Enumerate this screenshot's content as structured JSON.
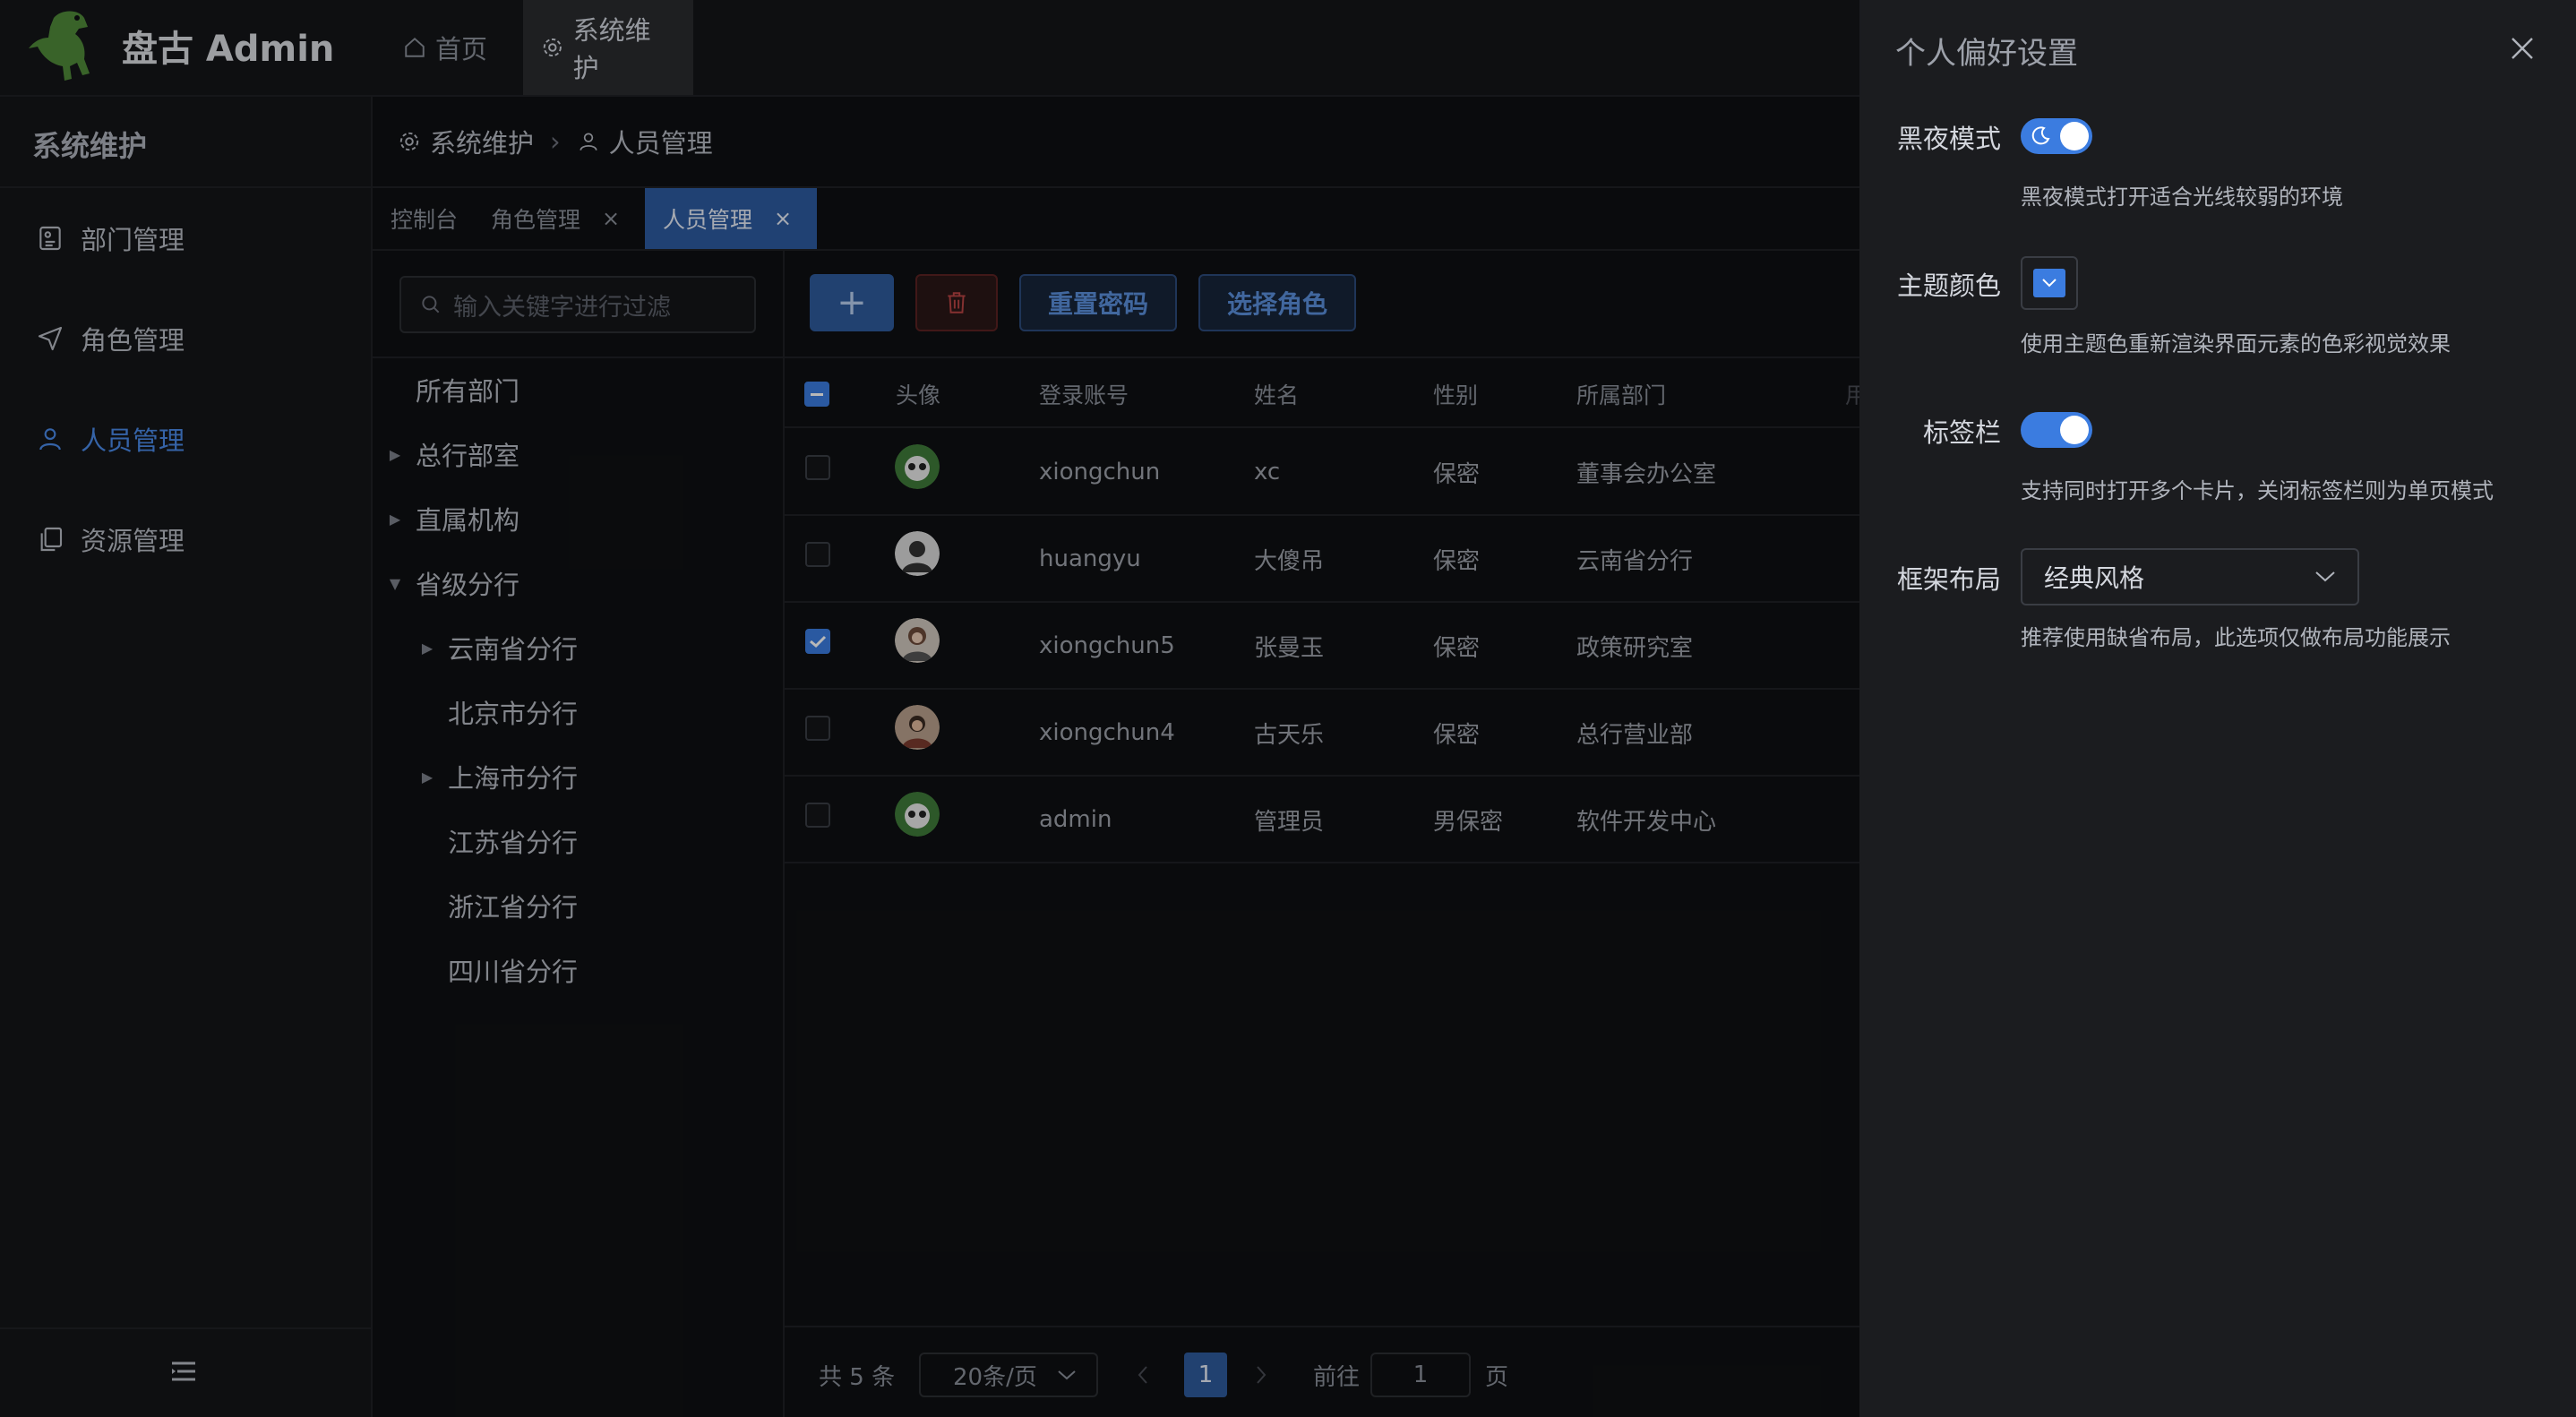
{
  "header": {
    "brand": "盘古 Admin",
    "tabs": [
      {
        "label": "首页",
        "icon": "home-icon"
      },
      {
        "label": "系统维护",
        "icon": "gear-icon"
      }
    ]
  },
  "sidebar": {
    "title": "系统维护",
    "items": [
      {
        "label": "部门管理",
        "icon": "department-icon"
      },
      {
        "label": "角色管理",
        "icon": "send-icon"
      },
      {
        "label": "人员管理",
        "icon": "user-icon",
        "active": true
      },
      {
        "label": "资源管理",
        "icon": "copy-icon"
      }
    ],
    "collapse_icon": "menu-fold-icon"
  },
  "breadcrumb": {
    "parent": "系统维护",
    "current": "人员管理"
  },
  "view_tabs": [
    {
      "label": "控制台"
    },
    {
      "label": "角色管理",
      "closable": true
    },
    {
      "label": "人员管理",
      "closable": true,
      "active": true
    }
  ],
  "tree": {
    "search_placeholder": "输入关键字进行过滤",
    "nodes": [
      {
        "label": "所有部门",
        "level": 0
      },
      {
        "label": "总行部室",
        "level": 0,
        "caret": "right"
      },
      {
        "label": "直属机构",
        "level": 0,
        "caret": "right"
      },
      {
        "label": "省级分行",
        "level": 0,
        "caret": "down"
      },
      {
        "label": "云南省分行",
        "level": 1,
        "caret": "right"
      },
      {
        "label": "北京市分行",
        "level": 1
      },
      {
        "label": "上海市分行",
        "level": 1,
        "caret": "right"
      },
      {
        "label": "江苏省分行",
        "level": 1
      },
      {
        "label": "浙江省分行",
        "level": 1
      },
      {
        "label": "四川省分行",
        "level": 1
      }
    ]
  },
  "toolbar": {
    "add_label": "+",
    "reset_label": "重置密码",
    "role_label": "选择角色"
  },
  "table": {
    "columns": [
      "头像",
      "登录账号",
      "姓名",
      "性别",
      "所属部门",
      "用"
    ],
    "rows": [
      {
        "account": "xiongchun",
        "name": "xc",
        "gender": "保密",
        "dept": "董事会办公室",
        "checked": false
      },
      {
        "account": "huangyu",
        "name": "大傻吊",
        "gender": "保密",
        "dept": "云南省分行",
        "checked": false
      },
      {
        "account": "xiongchun5",
        "name": "张曼玉",
        "gender": "保密",
        "dept": "政策研究室",
        "checked": true
      },
      {
        "account": "xiongchun4",
        "name": "古天乐",
        "gender": "保密",
        "dept": "总行营业部",
        "checked": false
      },
      {
        "account": "admin",
        "name": "管理员",
        "gender": "男保密",
        "dept": "软件开发中心",
        "checked": false
      }
    ]
  },
  "pagination": {
    "total": "共 5 条",
    "page_size": "20条/页",
    "current": "1",
    "goto_label": "前往",
    "goto_value": "1",
    "page_suffix": "页"
  },
  "drawer": {
    "title": "个人偏好设置",
    "dark_mode": {
      "label": "黑夜模式",
      "desc": "黑夜模式打开适合光线较弱的环境",
      "on": true
    },
    "theme_color": {
      "label": "主题颜色",
      "desc": "使用主题色重新渲染界面元素的色彩视觉效果",
      "value": "#3b7ce0"
    },
    "tab_bar": {
      "label": "标签栏",
      "desc": "支持同时打开多个卡片，关闭标签栏则为单页模式",
      "on": true
    },
    "layout": {
      "label": "框架布局",
      "desc": "推荐使用缺省布局，此选项仅做布局功能展示",
      "value": "经典风格"
    }
  }
}
